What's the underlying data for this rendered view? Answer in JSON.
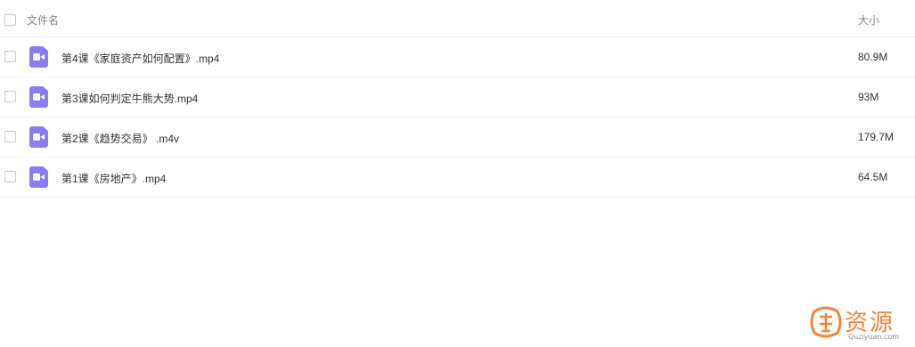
{
  "header": {
    "name_label": "文件名",
    "size_label": "大小"
  },
  "files": [
    {
      "name": "第4课《家庭资产如何配置》.mp4",
      "size": "80.9M",
      "icon": "video-file-icon"
    },
    {
      "name": "第3课如何判定牛熊大势.mp4",
      "size": "93M",
      "icon": "video-file-icon"
    },
    {
      "name": "第2课《趋势交易》 .m4v",
      "size": "179.7M",
      "icon": "video-file-icon"
    },
    {
      "name": "第1课《房地产》.mp4",
      "size": "64.5M",
      "icon": "video-file-icon"
    }
  ],
  "watermark": {
    "text": "资源",
    "url": "Quziyuan.com"
  },
  "colors": {
    "icon": "#8b7cf2",
    "watermark": "#f08535"
  }
}
